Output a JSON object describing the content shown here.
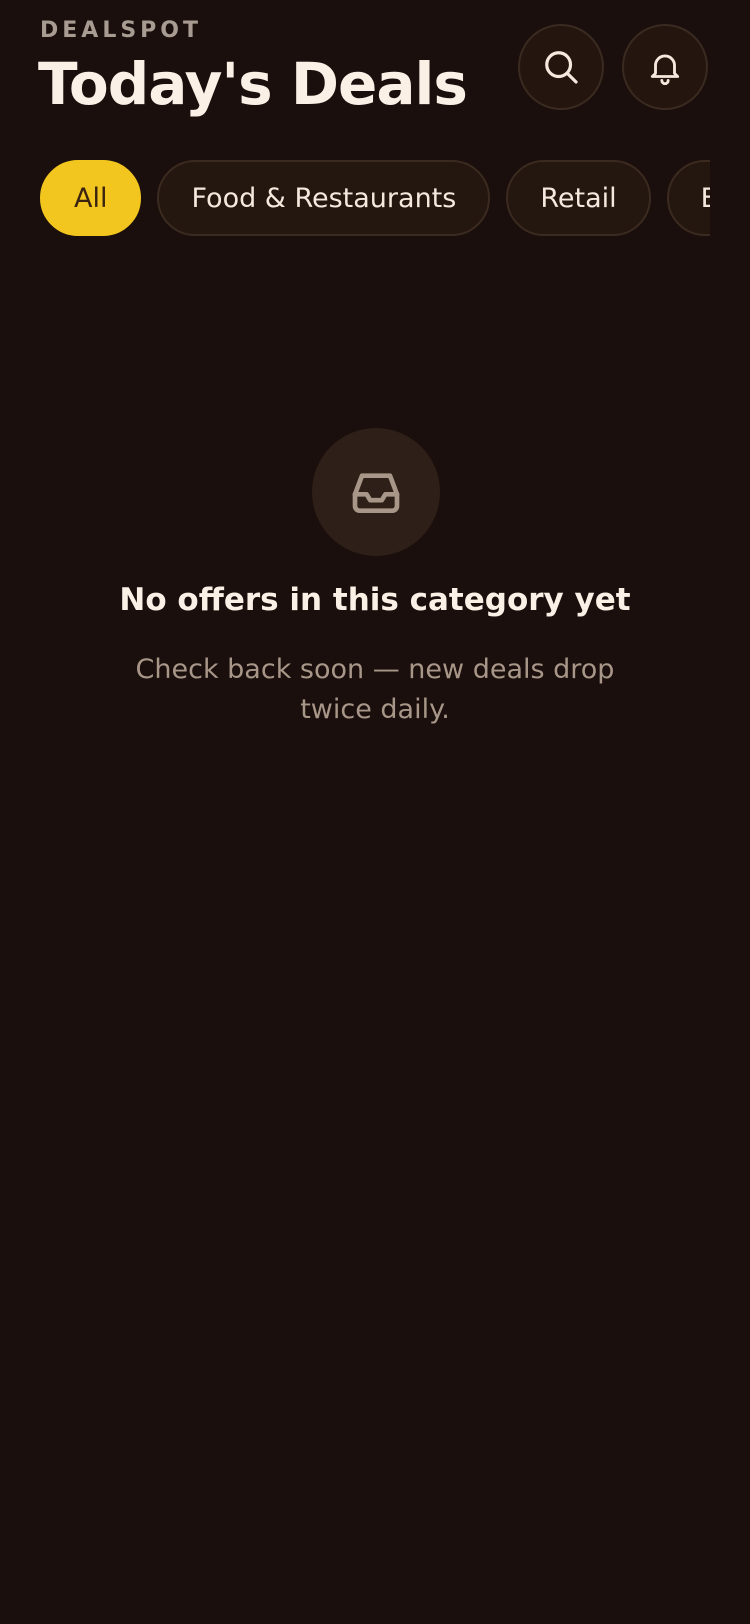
{
  "header": {
    "brand": "DEALSPOT",
    "title": "Today's Deals",
    "search_icon": "search-icon",
    "bell_icon": "bell-icon"
  },
  "filters": {
    "items": [
      {
        "label": "All",
        "active": true
      },
      {
        "label": "Food & Restaurants",
        "active": false
      },
      {
        "label": "Retail",
        "active": false
      },
      {
        "label": "Ele",
        "active": false
      }
    ]
  },
  "empty_state": {
    "icon": "inbox-icon",
    "title": "No offers in this category yet",
    "subtitle": "Check back soon — new deals drop twice daily."
  },
  "colors": {
    "background": "#1a0f0c",
    "accent": "#f3c61f",
    "text_primary": "#fbf0e6",
    "text_muted": "#a89789"
  }
}
